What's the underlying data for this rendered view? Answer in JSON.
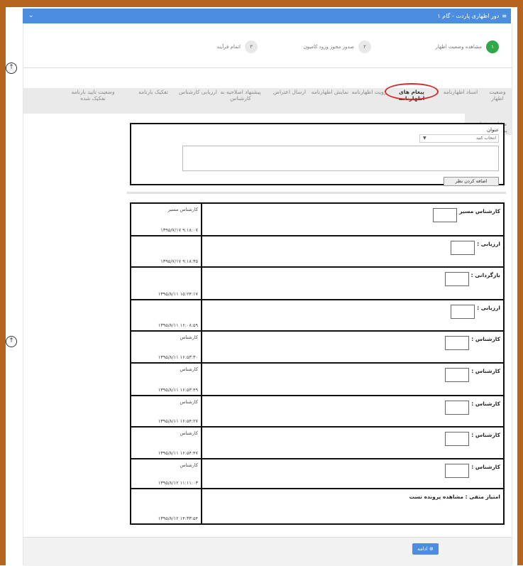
{
  "window": {
    "title": "دور اظهاری پاردت - گام ۱",
    "title_icon": "menu-icon",
    "collapse_icon": "chevron-down-icon"
  },
  "stepper": {
    "steps": [
      {
        "num": "۱",
        "label": "مشاهده وضعیت اظهار",
        "active": true
      },
      {
        "num": "۲",
        "label": "صدور مجوز ورود کامیون",
        "active": false
      },
      {
        "num": "۳",
        "label": "اتمام فرآیند",
        "active": false
      }
    ]
  },
  "tabs": {
    "items": [
      {
        "label": "وضعیت اظهار"
      },
      {
        "label": "اسناد اظهارنامه"
      },
      {
        "label": "پیغام های اظهارنامه",
        "selected": true
      },
      {
        "label": "رویت اظهارنامه"
      },
      {
        "label": "نمایش اظهارنامه"
      },
      {
        "label": "ارسال اعتراض"
      },
      {
        "label": "پیشنهاد اصلاحیه به کارشناس"
      },
      {
        "label": "ارزیابی کارشناس"
      },
      {
        "label": "تفکیک بارنامه"
      },
      {
        "label": "وضعیت تایید بارنامه تفکیک شده"
      },
      {
        "label": "مشاهده شناسه پرداخت سازمان"
      }
    ]
  },
  "comment_form": {
    "title_label": "عنوان",
    "select_value": "انتخاب کنید",
    "textarea_value": "",
    "add_button": "اضافه کردن نظر"
  },
  "messages": [
    {
      "who": "کارشناس مسیر",
      "when": "۹:۱۸:۰۷ ۱۳۹۵/۷/۱۷",
      "text": "کارشناس مسیر"
    },
    {
      "who": "",
      "when": "۹:۱۸:۳۵ ۱۳۹۵/۷/۱۷",
      "text": "ارزیابی :"
    },
    {
      "who": "",
      "when": "۱۵:۲۴:۱۷ ۱۳۹۵/۸/۱۱",
      "text": "بازگردانی :"
    },
    {
      "who": "",
      "when": "۱۶:۰۸:۵۹ ۱۳۹۵/۸/۱۱",
      "text": "ارزیابی :"
    },
    {
      "who": "کارشناس",
      "when": "۱۶:۵۳:۳۰ ۱۳۹۵/۸/۱۱",
      "text": "کارشناس :"
    },
    {
      "who": "کارشناس",
      "when": "۱۶:۵۳:۴۹ ۱۳۹۵/۸/۱۱",
      "text": "کارشناس :"
    },
    {
      "who": "کارشناس",
      "when": "۱۶:۵۴:۲۷ ۱۳۹۵/۸/۱۱",
      "text": "کارشناس :"
    },
    {
      "who": "کارشناس",
      "when": "۱۶:۵۴:۴۷ ۱۳۹۵/۸/۱۱",
      "text": "کارشناس :"
    },
    {
      "who": "کارشناس",
      "when": "۱۱:۱۱:۰۳ ۱۳۹۵/۸/۱۲",
      "text": "کارشناس :"
    },
    {
      "who": "",
      "when": "۱۴:۳۳:۵۴ ۱۳۹۵/۸/۱۲",
      "text": "امتیاز منفی : مشاهده پرونده تست"
    }
  ],
  "footer": {
    "continue_button": "ادامه",
    "continue_icon": "arrow-left-circle-icon"
  },
  "colors": {
    "frame": "#b5651d",
    "accent": "#4c8de0",
    "active_step": "#2ea84a",
    "highlight": "#d42a2a"
  }
}
